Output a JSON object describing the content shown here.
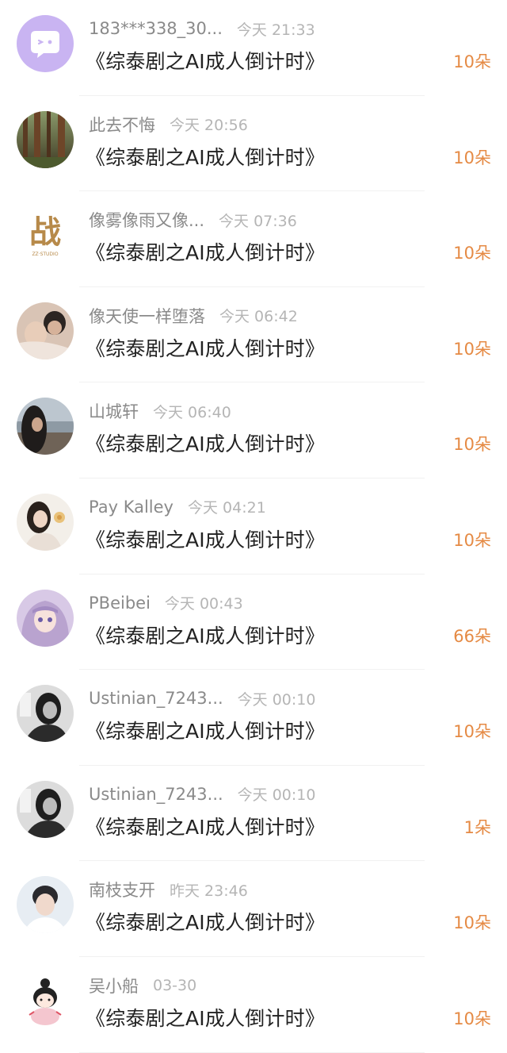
{
  "colors": {
    "count": "#e58a44",
    "name": "#8a8a8a",
    "time": "#b5b5b5",
    "title": "#222222"
  },
  "items": [
    {
      "name": "183***338_30...",
      "time": "今天 21:33",
      "title": "《综泰剧之AI成人倒计时》",
      "count": "10朵",
      "avatar": "wink-face-avatar"
    },
    {
      "name": "此去不悔",
      "time": "今天 20:56",
      "title": "《综泰剧之AI成人倒计时》",
      "count": "10朵",
      "avatar": "forest-avatar"
    },
    {
      "name": "像雾像雨又像...",
      "time": "今天 07:36",
      "title": "《综泰剧之AI成人倒计时》",
      "count": "10朵",
      "avatar": "calligraphy-logo-avatar",
      "avatar_text": "战",
      "avatar_subtext": "ZZ·STUDIO"
    },
    {
      "name": "像天使一样堕落",
      "time": "今天 06:42",
      "title": "《综泰剧之AI成人倒计时》",
      "count": "10朵",
      "avatar": "couple-photo-avatar"
    },
    {
      "name": "山城轩",
      "time": "今天 06:40",
      "title": "《综泰剧之AI成人倒计时》",
      "count": "10朵",
      "avatar": "beach-portrait-avatar"
    },
    {
      "name": "Pay Kalley",
      "time": "今天 04:21",
      "title": "《综泰剧之AI成人倒计时》",
      "count": "10朵",
      "avatar": "girl-with-flower-avatar"
    },
    {
      "name": "PBeibei",
      "time": "今天 00:43",
      "title": "《综泰剧之AI成人倒计时》",
      "count": "66朵",
      "avatar": "anime-girl-avatar"
    },
    {
      "name": "Ustinian_7243...",
      "time": "今天 00:10",
      "title": "《综泰剧之AI成人倒计时》",
      "count": "10朵",
      "avatar": "bw-portrait-avatar"
    },
    {
      "name": "Ustinian_7243...",
      "time": "今天 00:10",
      "title": "《综泰剧之AI成人倒计时》",
      "count": "1朵",
      "avatar": "bw-portrait-avatar"
    },
    {
      "name": "南枝支开",
      "time": "昨天 23:46",
      "title": "《综泰剧之AI成人倒计时》",
      "count": "10朵",
      "avatar": "male-portrait-avatar"
    },
    {
      "name": "吴小船",
      "time": "03-30",
      "title": "《综泰剧之AI成人倒计时》",
      "count": "10朵",
      "avatar": "cartoon-girl-avatar"
    }
  ]
}
